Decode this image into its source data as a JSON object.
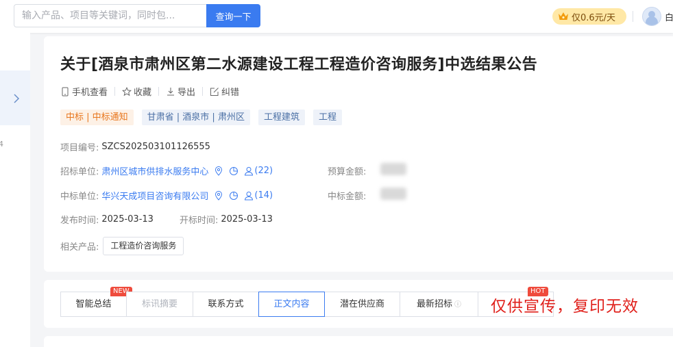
{
  "search": {
    "placeholder": "输入产品、项目等关键词，同时包...",
    "button_label": "查询一下"
  },
  "header": {
    "vip_label": "仅0.6元/天",
    "user_name": "白"
  },
  "sidebar": {
    "partial_label": "4"
  },
  "notice": {
    "title": "关于[酒泉市肃州区第二水源建设工程工程造价咨询服务]中选结果公告",
    "actions": [
      {
        "label": "手机查看",
        "icon": "phone-icon"
      },
      {
        "label": "收藏",
        "icon": "star-icon"
      },
      {
        "label": "导出",
        "icon": "download-icon"
      },
      {
        "label": "纠错",
        "icon": "edit-icon"
      }
    ],
    "tags": [
      "中标 | 中标通知",
      "甘肃省 | 酒泉市 | 肃州区",
      "工程建筑",
      "工程"
    ],
    "project_no_label": "项目编号:",
    "project_no": "SZCS202503101126555",
    "tenderer_label": "招标单位:",
    "tenderer": "肃州区城市供排水服务中心",
    "tenderer_count": "(22)",
    "budget_label": "预算金额:",
    "winner_label": "中标单位:",
    "winner": "华兴天成项目咨询有限公司",
    "winner_count": "(14)",
    "award_label": "中标金额:",
    "publish_label": "发布时间:",
    "publish_date": "2025-03-13",
    "open_label": "开标时间:",
    "open_date": "2025-03-13",
    "product_label": "相关产品:",
    "product": "工程造价咨询服务"
  },
  "tabs": [
    {
      "label": "智能总结",
      "badge": "NEW"
    },
    {
      "label": "标讯摘要"
    },
    {
      "label": "联系方式"
    },
    {
      "label": "正文内容"
    },
    {
      "label": "潜在供应商"
    },
    {
      "label": "最新招标"
    },
    {
      "label": "",
      "badge": "HOT"
    }
  ],
  "watermark": "仅供宣传，复印无效",
  "colors": {
    "accent": "#3a7bf0",
    "tag_orange": "#e8761d",
    "badge_red": "#ef4b3c",
    "watermark_red": "#e0201b"
  }
}
